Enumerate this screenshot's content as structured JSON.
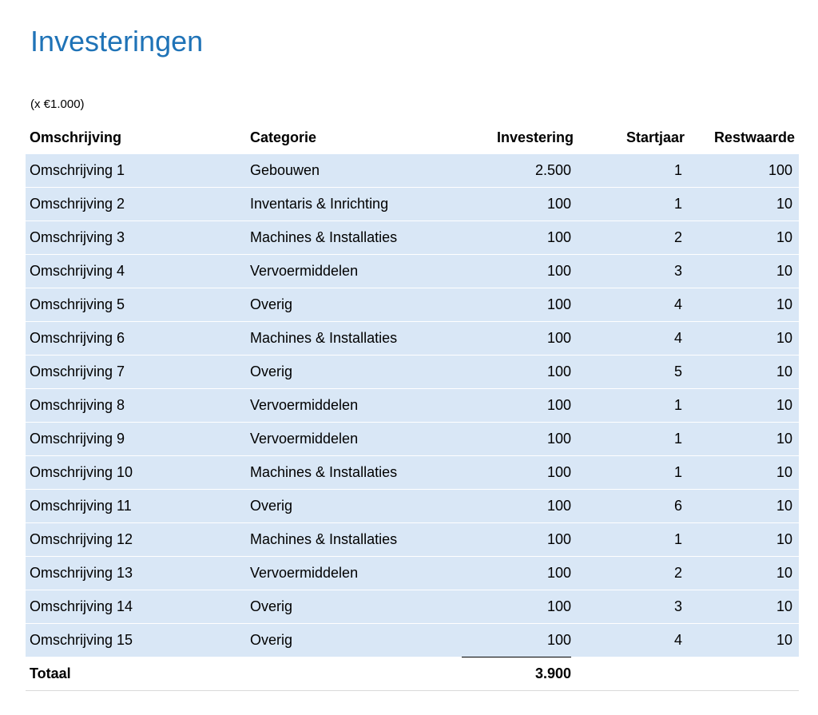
{
  "page": {
    "title": "Investeringen",
    "unit_note": "(x €1.000)",
    "title_color": "#1f73b7",
    "row_fill": "#d9e7f6"
  },
  "table": {
    "headers": [
      "Omschrijving",
      "Categorie",
      "Investering",
      "Startjaar",
      "Restwaarde"
    ],
    "rows": [
      [
        "Omschrijving 1",
        "Gebouwen",
        "2.500",
        "1",
        "100"
      ],
      [
        "Omschrijving 2",
        "Inventaris & Inrichting",
        "100",
        "1",
        "10"
      ],
      [
        "Omschrijving 3",
        "Machines & Installaties",
        "100",
        "2",
        "10"
      ],
      [
        "Omschrijving 4",
        "Vervoermiddelen",
        "100",
        "3",
        "10"
      ],
      [
        "Omschrijving 5",
        "Overig",
        "100",
        "4",
        "10"
      ],
      [
        "Omschrijving 6",
        "Machines & Installaties",
        "100",
        "4",
        "10"
      ],
      [
        "Omschrijving 7",
        "Overig",
        "100",
        "5",
        "10"
      ],
      [
        "Omschrijving 8",
        "Vervoermiddelen",
        "100",
        "1",
        "10"
      ],
      [
        "Omschrijving 9",
        "Vervoermiddelen",
        "100",
        "1",
        "10"
      ],
      [
        "Omschrijving 10",
        "Machines & Installaties",
        "100",
        "1",
        "10"
      ],
      [
        "Omschrijving 11",
        "Overig",
        "100",
        "6",
        "10"
      ],
      [
        "Omschrijving 12",
        "Machines & Installaties",
        "100",
        "1",
        "10"
      ],
      [
        "Omschrijving 13",
        "Vervoermiddelen",
        "100",
        "2",
        "10"
      ],
      [
        "Omschrijving 14",
        "Overig",
        "100",
        "3",
        "10"
      ],
      [
        "Omschrijving 15",
        "Overig",
        "100",
        "4",
        "10"
      ]
    ],
    "total": {
      "label": "Totaal",
      "investering": "3.900"
    }
  }
}
